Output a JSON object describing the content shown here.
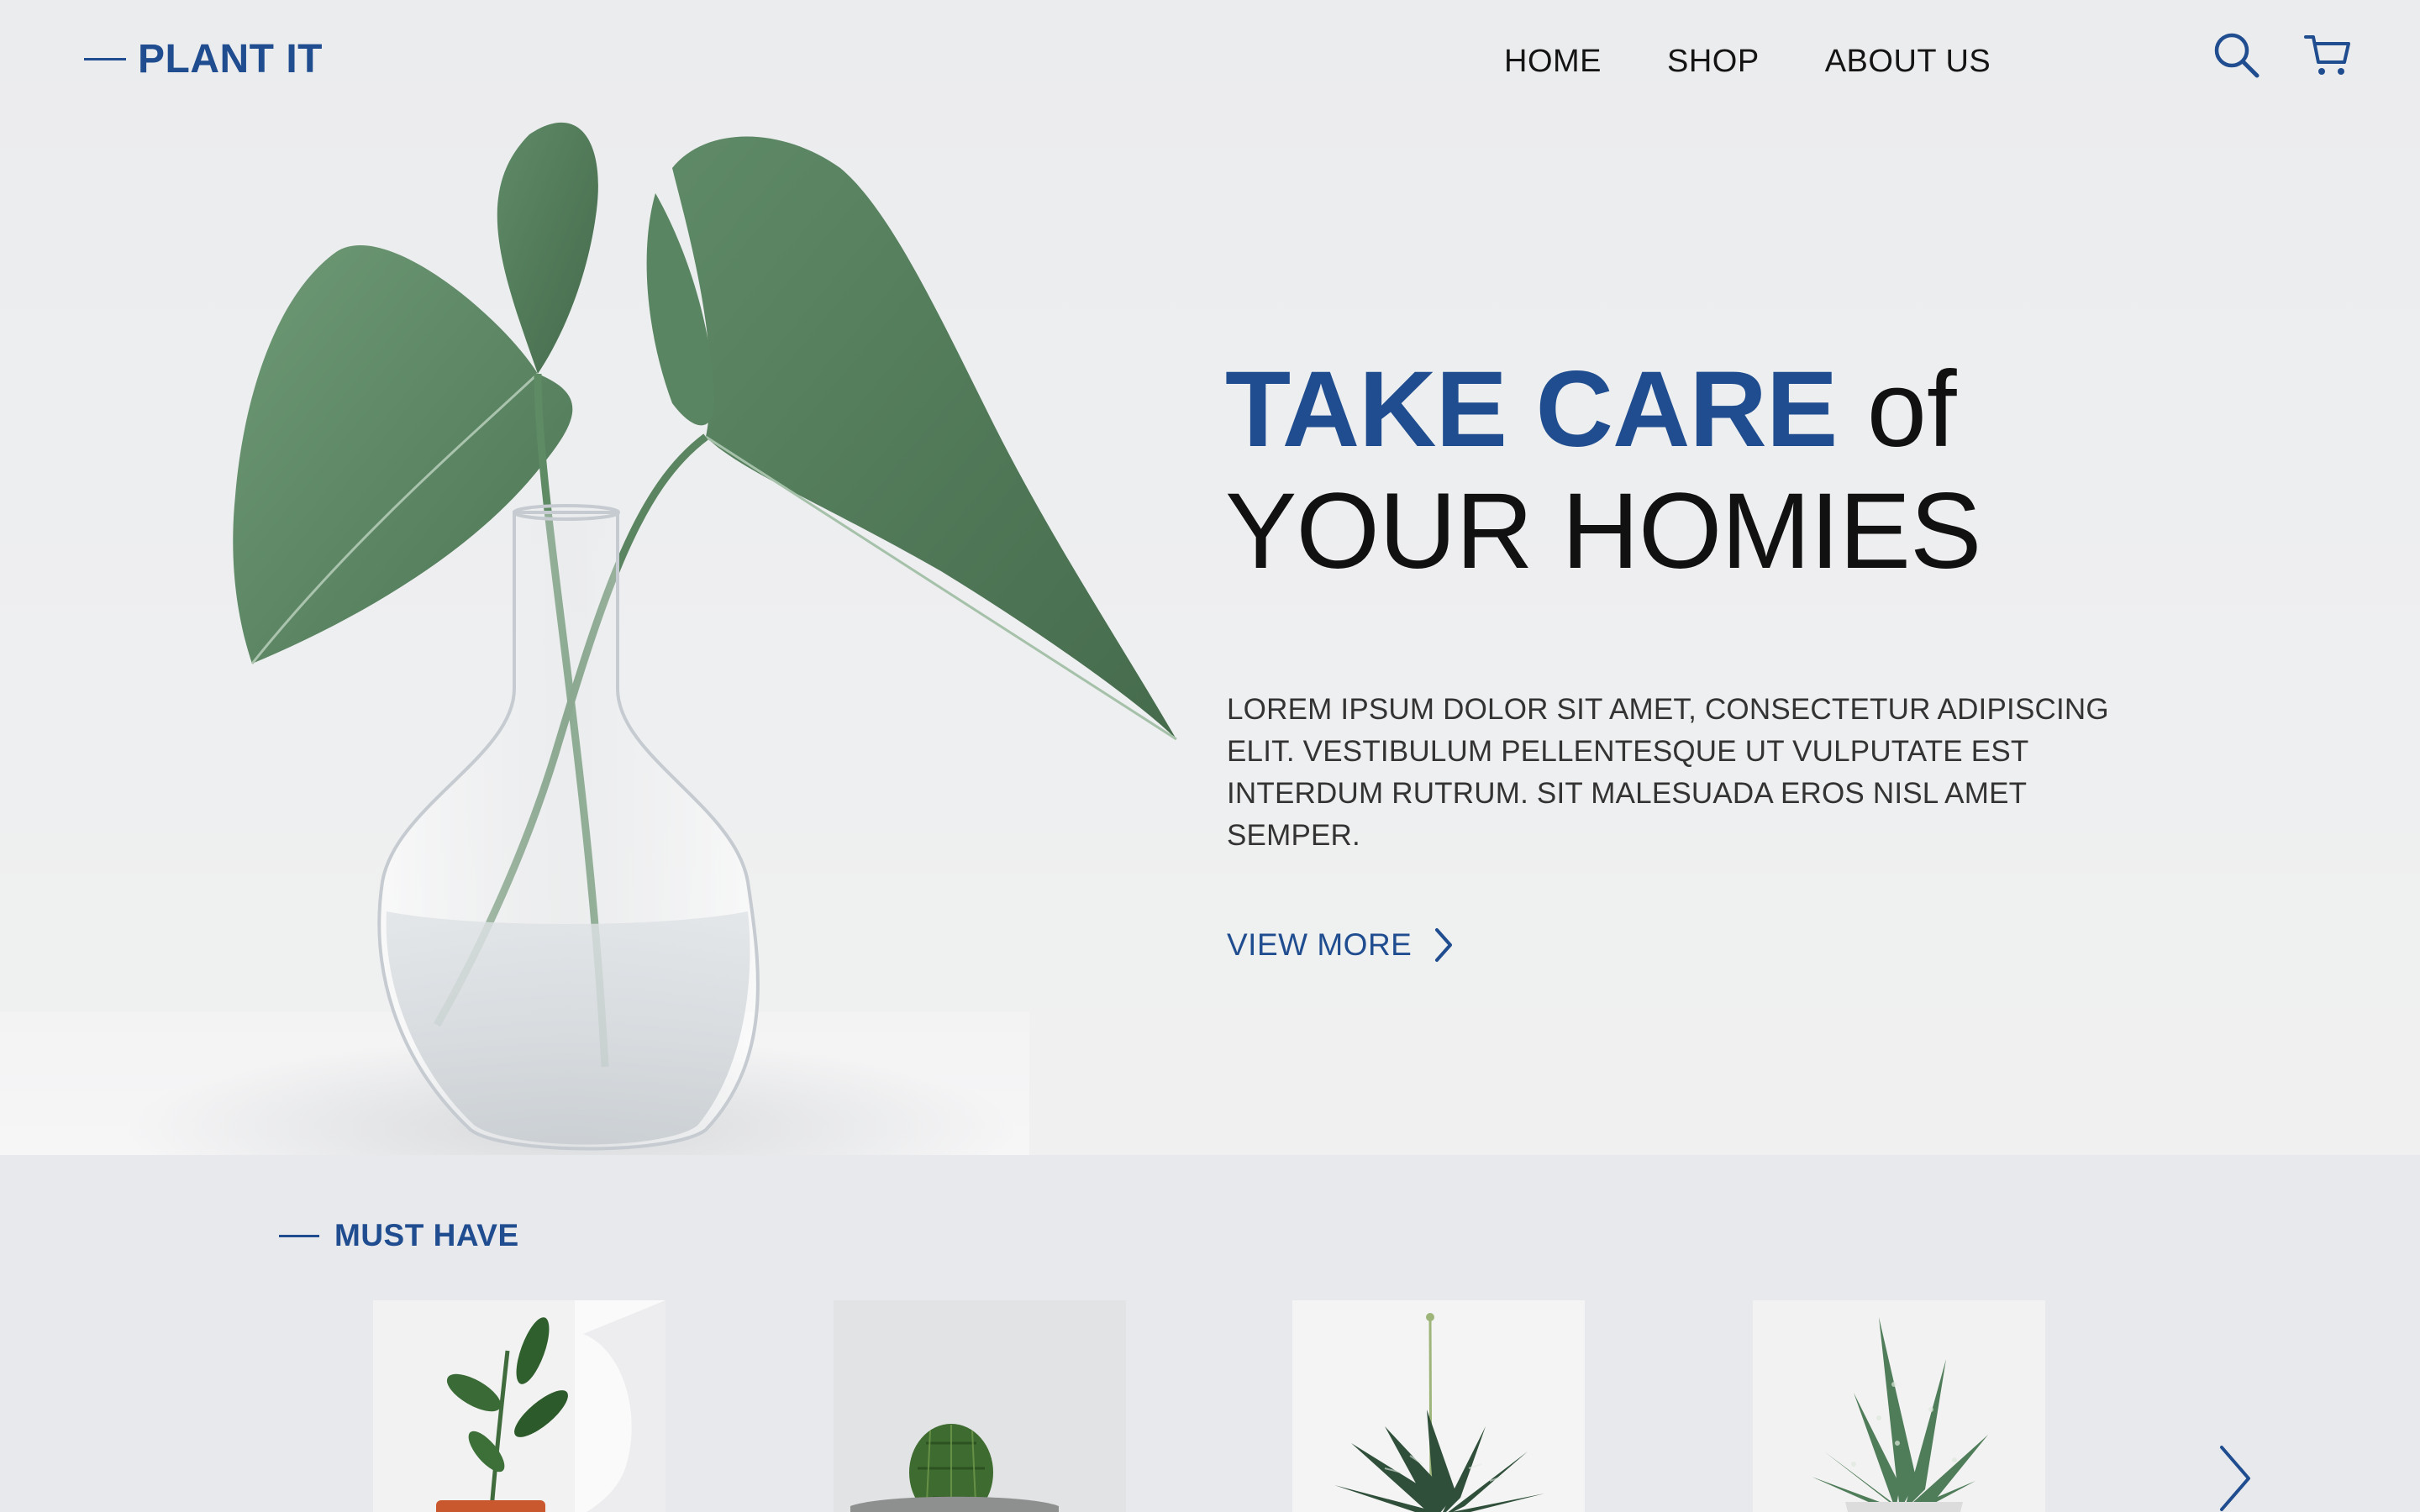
{
  "brand": {
    "name": "PLANT IT"
  },
  "nav": {
    "items": [
      "HOME",
      "SHOP",
      "ABOUT US"
    ]
  },
  "header_icons": [
    "search-icon",
    "cart-icon"
  ],
  "hero": {
    "headline_strong": "TAKE CARE",
    "headline_light": "of",
    "headline_line2": "YOUR HOMIES",
    "body": "LOREM IPSUM DOLOR SIT AMET, CONSECTETUR ADIPISCING ELIT. VESTIBULUM PELLENTESQUE UT VULPUTATE EST INTERDUM RUTRUM. SIT MALESUADA EROS NISL AMET SEMPER.",
    "cta_label": "VIEW MORE"
  },
  "must_have": {
    "title": "MUST HAVE",
    "products": [
      "rubber-plant",
      "cactus",
      "haworthia",
      "aloe"
    ]
  },
  "colors": {
    "brand_blue": "#1f4d8f",
    "background": "#e9eaec",
    "text": "#111111"
  }
}
